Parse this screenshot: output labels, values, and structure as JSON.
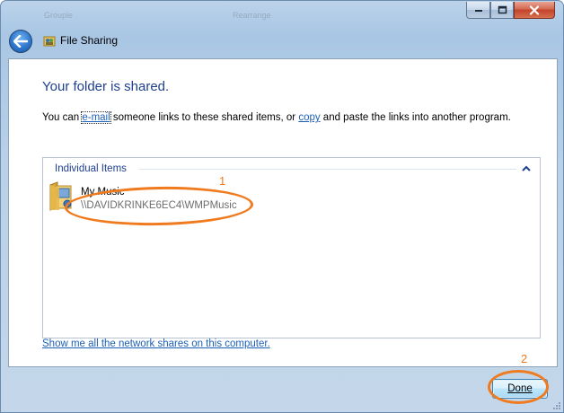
{
  "window": {
    "title": "File Sharing",
    "behind_titlebar_text": [
      "Grouple",
      "Rearrange"
    ]
  },
  "content": {
    "heading": "Your folder is shared.",
    "instructions": {
      "before_email": "You can ",
      "email_link": "e-mail",
      "between": " someone links to these shared items, or ",
      "copy_link": "copy",
      "after": " and paste the links into another program."
    },
    "items_group": {
      "header": "Individual Items",
      "items": [
        {
          "name": "My Music",
          "path": "\\\\DAVIDKRINKE6EC4\\WMPMusic",
          "icon": "music-folder-icon"
        }
      ]
    },
    "network_link": "Show me all the network shares on this computer."
  },
  "footer": {
    "done_label": "Done"
  },
  "callouts": [
    {
      "number": "1"
    },
    {
      "number": "2"
    }
  ],
  "colors": {
    "heading": "#1e3f8f",
    "link": "#1c5fb8",
    "callout": "#f07a1e",
    "path_text": "#6d6d6d"
  }
}
